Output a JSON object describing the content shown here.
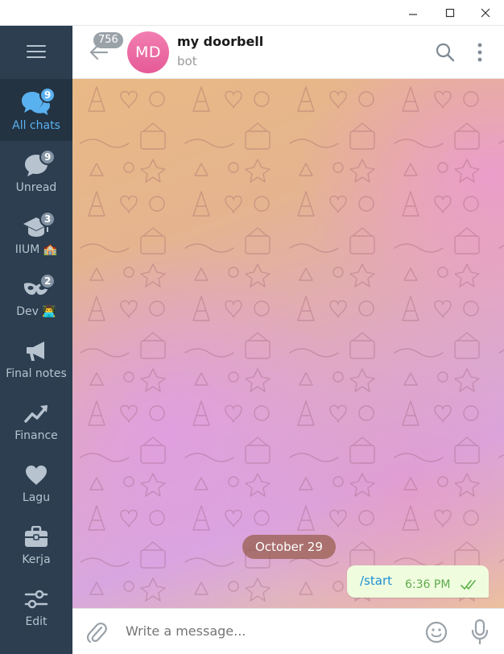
{
  "colors": {
    "sidebar_bg": "#2c3e50",
    "sidebar_active_bg": "#233342",
    "accent": "#5ab1f0",
    "avatar": "#e9689f",
    "bubble_bg": "#effdde",
    "bubble_link": "#1d8fd5",
    "bubble_time": "#60a94e"
  },
  "window_controls": [
    "minimize-icon",
    "maximize-icon",
    "close-icon"
  ],
  "sidebar": {
    "menu_icon": "hamburger-icon",
    "folders": [
      {
        "label": "All chats",
        "badge": "9",
        "icon": "chat-bubbles-icon",
        "active": true
      },
      {
        "label": "Unread",
        "badge": "9",
        "icon": "chat-bubble-icon",
        "active": false
      },
      {
        "label": "IIUM 🏫",
        "badge": "3",
        "icon": "graduation-cap-icon",
        "active": false
      },
      {
        "label": "Dev 👨‍💻",
        "badge": "2",
        "icon": "mask-icon",
        "active": false
      },
      {
        "label": "Final notes",
        "badge": "",
        "icon": "megaphone-icon",
        "active": false
      },
      {
        "label": "Finance",
        "badge": "",
        "icon": "chart-up-icon",
        "active": false
      },
      {
        "label": "Lagu",
        "badge": "",
        "icon": "heart-icon",
        "active": false
      },
      {
        "label": "Kerja",
        "badge": "",
        "icon": "briefcase-icon",
        "active": false
      },
      {
        "label": "Edit",
        "badge": "",
        "icon": "sliders-icon",
        "active": false
      }
    ]
  },
  "header": {
    "back_count": "756",
    "avatar_initials": "MD",
    "title": "my doorbell",
    "subtitle": "bot"
  },
  "messages": {
    "date_separator": "October 29",
    "outgoing": {
      "text": "/start",
      "time": "6:36 PM",
      "status": "read-double-check"
    }
  },
  "composer": {
    "placeholder": "Write a message..."
  }
}
